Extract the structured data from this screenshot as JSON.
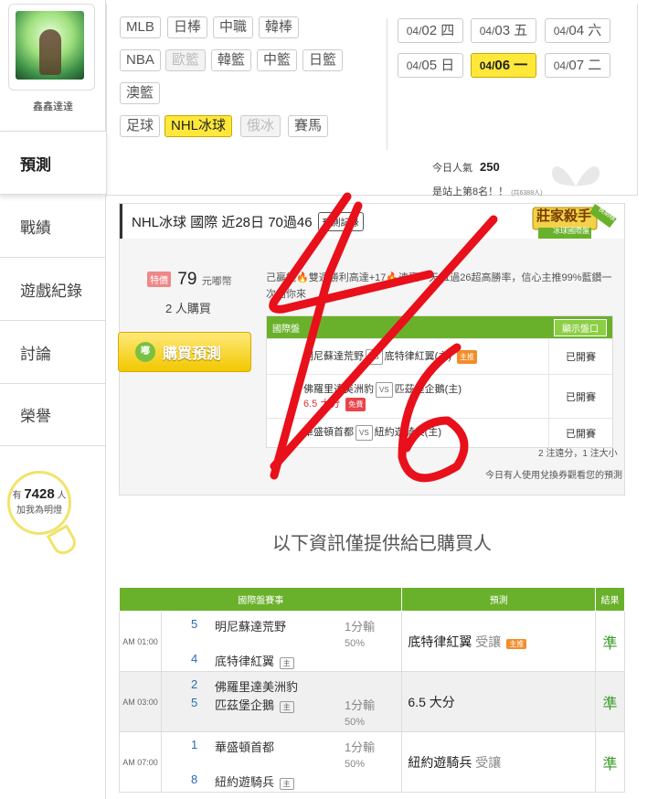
{
  "sidebar": {
    "username": "鑫鑫達達",
    "nav": [
      "預測",
      "戰績",
      "遊戲紀錄",
      "討論",
      "榮譽"
    ],
    "fans": {
      "prefix": "有",
      "count": "7428",
      "suffix": "人",
      "line2": "加我為明燈"
    }
  },
  "leagues": {
    "row1": [
      "MLB",
      "日棒",
      "中職",
      "韓棒"
    ],
    "row2": [
      "NBA",
      "歐籃",
      "韓籃",
      "中籃",
      "日籃"
    ],
    "row3": [
      "澳籃"
    ],
    "row4": [
      "足球",
      "NHL冰球",
      "俄冰",
      "賽馬"
    ]
  },
  "dates": [
    {
      "md": "04/",
      "d": "02",
      "w": "四"
    },
    {
      "md": "04/",
      "d": "03",
      "w": "五"
    },
    {
      "md": "04/",
      "d": "04",
      "w": "六"
    },
    {
      "md": "04/",
      "d": "05",
      "w": "日"
    },
    {
      "md": "04/",
      "d": "06",
      "w": "一"
    },
    {
      "md": "04/",
      "d": "07",
      "w": "二"
    }
  ],
  "stats": {
    "pop_label": "今日人氣",
    "pop_value": "250",
    "rank_text": "是站上第8名！！",
    "rank_note": "(共6388人)"
  },
  "card": {
    "title": "NHL冰球 國際 近28日 70過46",
    "record_btn": "預測記錄",
    "badge_main": "莊家殺手",
    "badge_sub": "冰球國際盤",
    "badge_corner": "長期穩定",
    "price_tag": "特價",
    "price": "79",
    "price_unit": "元嘟幣",
    "buyers": "2 人購買",
    "buy_btn": "購買預測",
    "coin_label": "嘟",
    "desc": "己贏錢🔥雙週勝利高達+17🔥連贏一天31過26超高勝率，信心主推99%藍鑽一次給你來",
    "table_head": "國際盤",
    "show_btn": "顯示盤口",
    "rows": [
      {
        "t1": "明尼蘇達荒野",
        "t2": "底特律紅翼(主)",
        "tag": "主推",
        "tag_type": "o",
        "status": "已開賽"
      },
      {
        "t1": "佛羅里達美洲豹",
        "t2": "匹茲堡企鵝(主)",
        "extra": "6.5 大分",
        "tag": "免費",
        "tag_type": "r",
        "status": "已開賽"
      },
      {
        "t1": "華盛頓首都",
        "t2": "紐約遊騎兵(主)",
        "status": "已開賽"
      }
    ],
    "vs": "VS",
    "note1": "2 注遠分，1 注大小",
    "note2": "今日有人使用兌換券觀看您的預測"
  },
  "info_line": "以下資訊僅提供給已購買人",
  "results": {
    "headers": [
      "國際盤賽事",
      "預測",
      "結果"
    ],
    "rows": [
      {
        "time": "AM 01:00",
        "n1": "5",
        "t1": "明尼蘇達荒野",
        "n2": "4",
        "t2": "底特律紅翼",
        "home": "主",
        "line1": "1分輸",
        "line2": "50%",
        "pred": "底特律紅翼",
        "pred_note": "受讓",
        "pred_tag": "主推",
        "result": "準"
      },
      {
        "time": "AM 03:00",
        "n1": "2",
        "t1": "佛羅里達美洲豹",
        "n2": "5",
        "t2": "匹茲堡企鵝",
        "home": "主",
        "line1": "1分輸",
        "line2": "50%",
        "pred": "6.5 大分",
        "pred_note": "",
        "pred_tag": "",
        "result": "準"
      },
      {
        "time": "AM 07:00",
        "n1": "1",
        "t1": "華盛頓首都",
        "n2": "8",
        "t2": "紐約遊騎兵",
        "home": "主",
        "line1": "1分輸",
        "line2": "50%",
        "pred": "紐約遊騎兵",
        "pred_note": "受讓",
        "pred_tag": "",
        "result": "準"
      }
    ]
  },
  "overlay": {
    "text": "4/6",
    "color": "#e8101a"
  }
}
